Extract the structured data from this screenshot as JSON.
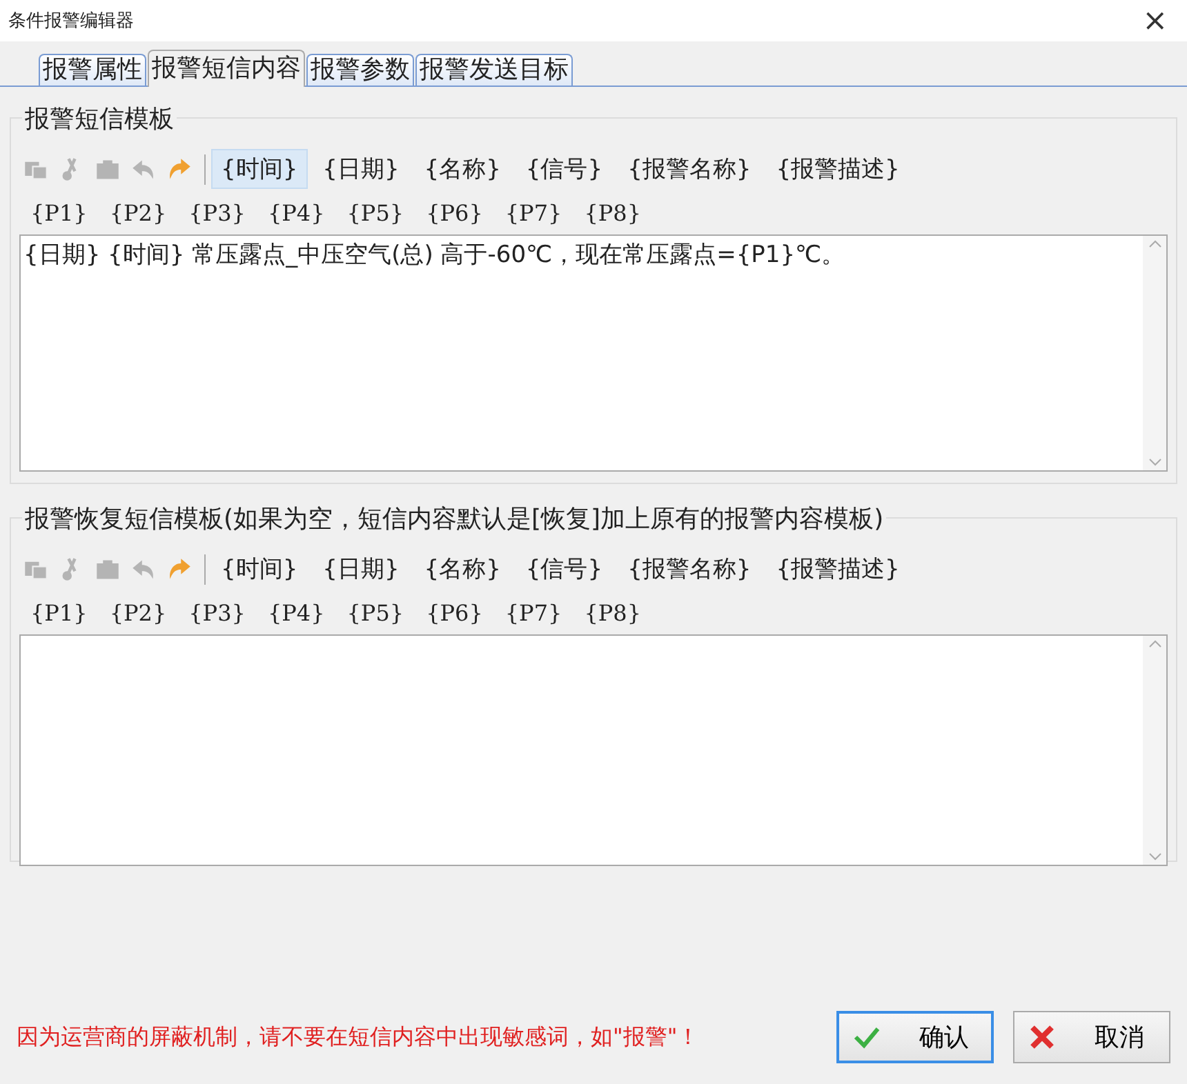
{
  "window": {
    "title": "条件报警编辑器",
    "close": "×"
  },
  "tabs": [
    {
      "label": "报警属性",
      "selected": false
    },
    {
      "label": "报警短信内容",
      "selected": true
    },
    {
      "label": "报警参数",
      "selected": false
    },
    {
      "label": "报警发送目标",
      "selected": false
    }
  ],
  "groups": [
    {
      "title": "报警短信模板",
      "tools": [
        {
          "kind": "copy",
          "disabled": true
        },
        {
          "kind": "cut",
          "disabled": true
        },
        {
          "kind": "paste",
          "disabled": true
        },
        {
          "kind": "undo",
          "disabled": true
        },
        {
          "kind": "redo",
          "disabled": false
        }
      ],
      "tokens": [
        {
          "label": "{时间}",
          "selected": true
        },
        {
          "label": "{日期}",
          "selected": false
        },
        {
          "label": "{名称}",
          "selected": false
        },
        {
          "label": "{信号}",
          "selected": false
        },
        {
          "label": "{报警名称}",
          "selected": false
        },
        {
          "label": "{报警描述}",
          "selected": false
        }
      ],
      "params": [
        "{P1}",
        "{P2}",
        "{P3}",
        "{P4}",
        "{P5}",
        "{P6}",
        "{P7}",
        "{P8}"
      ],
      "content": "{日期} {时间} 常压露点_中压空气(总) 高于-60℃，现在常压露点={P1}℃。"
    },
    {
      "title": "报警恢复短信模板(如果为空，短信内容默认是[恢复]加上原有的报警内容模板)",
      "tools": [
        {
          "kind": "copy",
          "disabled": true
        },
        {
          "kind": "cut",
          "disabled": true
        },
        {
          "kind": "paste",
          "disabled": true
        },
        {
          "kind": "undo",
          "disabled": true
        },
        {
          "kind": "redo",
          "disabled": false
        }
      ],
      "tokens": [
        {
          "label": "{时间}",
          "selected": false
        },
        {
          "label": "{日期}",
          "selected": false
        },
        {
          "label": "{名称}",
          "selected": false
        },
        {
          "label": "{信号}",
          "selected": false
        },
        {
          "label": "{报警名称}",
          "selected": false
        },
        {
          "label": "{报警描述}",
          "selected": false
        }
      ],
      "params": [
        "{P1}",
        "{P2}",
        "{P3}",
        "{P4}",
        "{P5}",
        "{P6}",
        "{P7}",
        "{P8}"
      ]
    }
  ],
  "warning": "因为运营商的屏蔽机制，请不要在短信内容中出现敏感词，如\"报警\"！",
  "buttons": [
    {
      "kind": "ok",
      "label": "确认"
    },
    {
      "kind": "cancel",
      "label": "取消"
    }
  ]
}
